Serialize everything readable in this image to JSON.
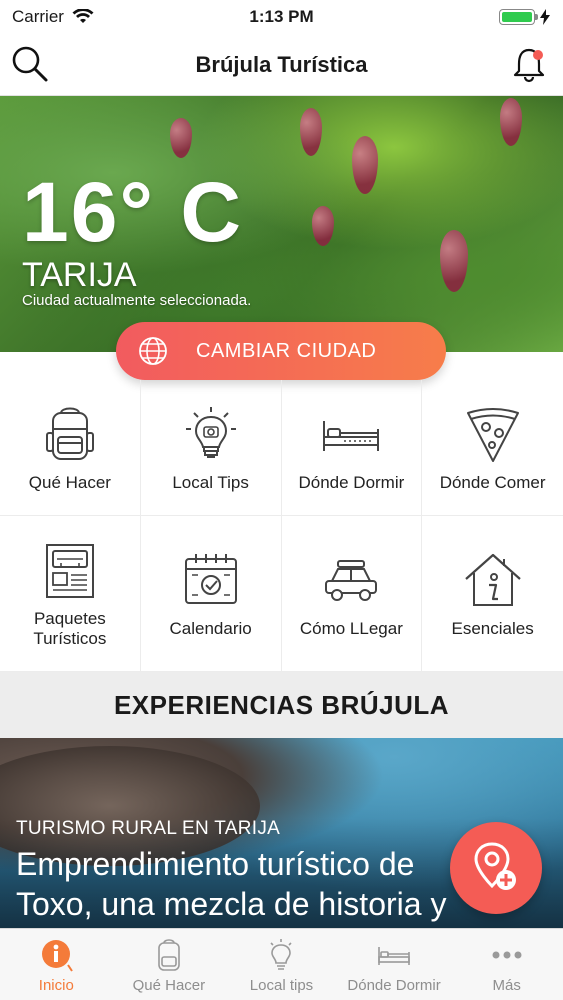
{
  "status_bar": {
    "carrier": "Carrier",
    "time": "1:13 PM",
    "battery_level": 1.0
  },
  "nav": {
    "title": "Brújula Turística"
  },
  "hero": {
    "temperature": "16° C",
    "city": "TARIJA",
    "subtitle": "Ciudad actualmente seleccionada."
  },
  "change_city": {
    "label": "CAMBIAR CIUDAD"
  },
  "categories": [
    {
      "label": "Qué Hacer",
      "icon": "backpack-icon"
    },
    {
      "label": "Local Tips",
      "icon": "lightbulb-icon"
    },
    {
      "label": "Dónde Dormir",
      "icon": "bed-icon"
    },
    {
      "label": "Dónde Comer",
      "icon": "pizza-icon"
    },
    {
      "label": "Paquetes\nTurísticos",
      "icon": "newspaper-icon"
    },
    {
      "label": "Calendario",
      "icon": "calendar-icon"
    },
    {
      "label": "Cómo LLegar",
      "icon": "car-icon"
    },
    {
      "label": "Esenciales",
      "icon": "info-house-icon"
    }
  ],
  "experiences": {
    "header": "EXPERIENCIAS BRÚJULA",
    "feature": {
      "kicker": "TURISMO RURAL EN TARIJA",
      "title_line1": "Emprendimiento turístico de",
      "title_line2": "Toxo, una mezcla de historia y"
    }
  },
  "tab_bar": [
    {
      "label": "Inicio",
      "icon": "info-icon",
      "active": true
    },
    {
      "label": "Qué Hacer",
      "icon": "backpack-icon",
      "active": false
    },
    {
      "label": "Local tips",
      "icon": "lightbulb-icon",
      "active": false
    },
    {
      "label": "Dónde Dormir",
      "icon": "bed-icon",
      "active": false
    },
    {
      "label": "Más",
      "icon": "more-icon",
      "active": false
    }
  ],
  "colors": {
    "accent": "#f25b5f",
    "accent_orange": "#f77d4a",
    "tab_active": "#f47b3a",
    "battery": "#2fcb4e"
  }
}
